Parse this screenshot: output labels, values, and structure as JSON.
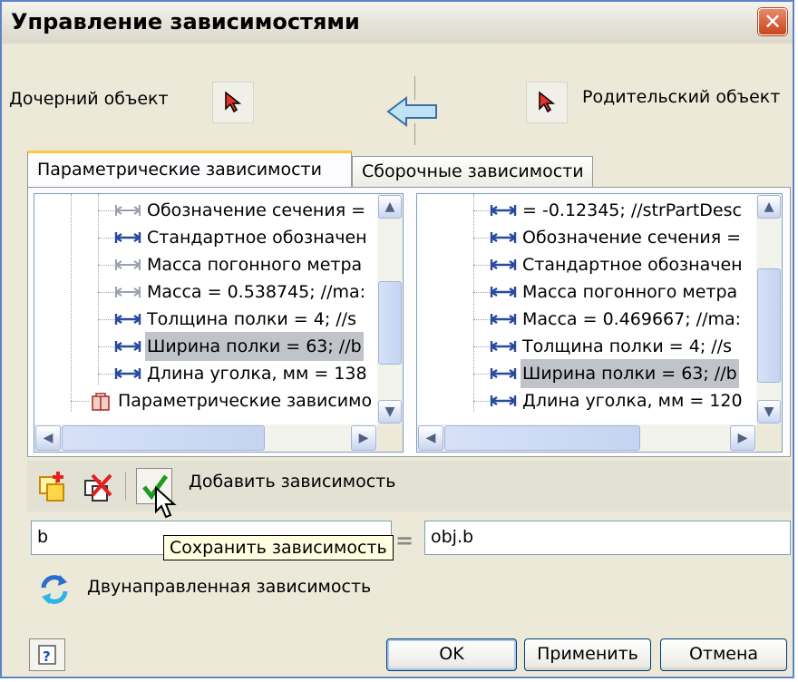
{
  "window": {
    "title": "Управление зависимостями"
  },
  "objects": {
    "child_label": "Дочерний объект",
    "parent_label": "Родительский объект"
  },
  "tabs": [
    {
      "label": "Параметрические зависимости",
      "active": true
    },
    {
      "label": "Сборочные зависимости",
      "active": false
    }
  ],
  "left_tree": {
    "items": [
      {
        "text": "Обозначение сечения = ",
        "icon": "parameter-icon-disabled",
        "selected": false
      },
      {
        "text": "Стандартное обозначен",
        "icon": "parameter-icon",
        "selected": false
      },
      {
        "text": "Масса погонного метра",
        "icon": "parameter-icon-disabled",
        "selected": false
      },
      {
        "text": "Масса = 0.538745; //ma:",
        "icon": "parameter-icon-disabled",
        "selected": false
      },
      {
        "text": "Толщина полки = 4; //s",
        "icon": "parameter-icon",
        "selected": false
      },
      {
        "text": "Ширина полки = 63; //b",
        "icon": "parameter-icon",
        "selected": true
      },
      {
        "text": "Длина уголка, мм = 138",
        "icon": "parameter-icon",
        "selected": false
      },
      {
        "text": "Параметрические зависимо",
        "icon": "dependency-folder-icon",
        "selected": false
      }
    ]
  },
  "right_tree": {
    "items": [
      {
        "text": " = -0.12345; //strPartDesc",
        "icon": "parameter-icon",
        "selected": false
      },
      {
        "text": "Обозначение сечения = ",
        "icon": "parameter-icon",
        "selected": false
      },
      {
        "text": "Стандартное обозначен",
        "icon": "parameter-icon",
        "selected": false
      },
      {
        "text": "Масса погонного метра",
        "icon": "parameter-icon",
        "selected": false
      },
      {
        "text": "Масса = 0.469667; //ma:",
        "icon": "parameter-icon",
        "selected": false
      },
      {
        "text": "Толщина полки = 4; //s",
        "icon": "parameter-icon",
        "selected": false
      },
      {
        "text": "Ширина полки = 63; //b",
        "icon": "parameter-icon",
        "selected": true
      },
      {
        "text": "Длина уголка, мм = 120",
        "icon": "parameter-icon",
        "selected": false
      }
    ]
  },
  "toolbar": {
    "add_dependency_label": "Добавить зависимость"
  },
  "tooltip": {
    "text": "Сохранить зависимость"
  },
  "expression": {
    "left_value": "b",
    "right_value": "obj.b"
  },
  "bidirectional": {
    "label": "Двунаправленная зависимость"
  },
  "buttons": {
    "ok": "OK",
    "apply": "Применить",
    "cancel": "Отмена"
  },
  "colors": {
    "title_close": "#c9451d",
    "selection": "#c1c3cb",
    "tab_accent": "#ffc83c",
    "param_icon": "#2a4aa0"
  }
}
